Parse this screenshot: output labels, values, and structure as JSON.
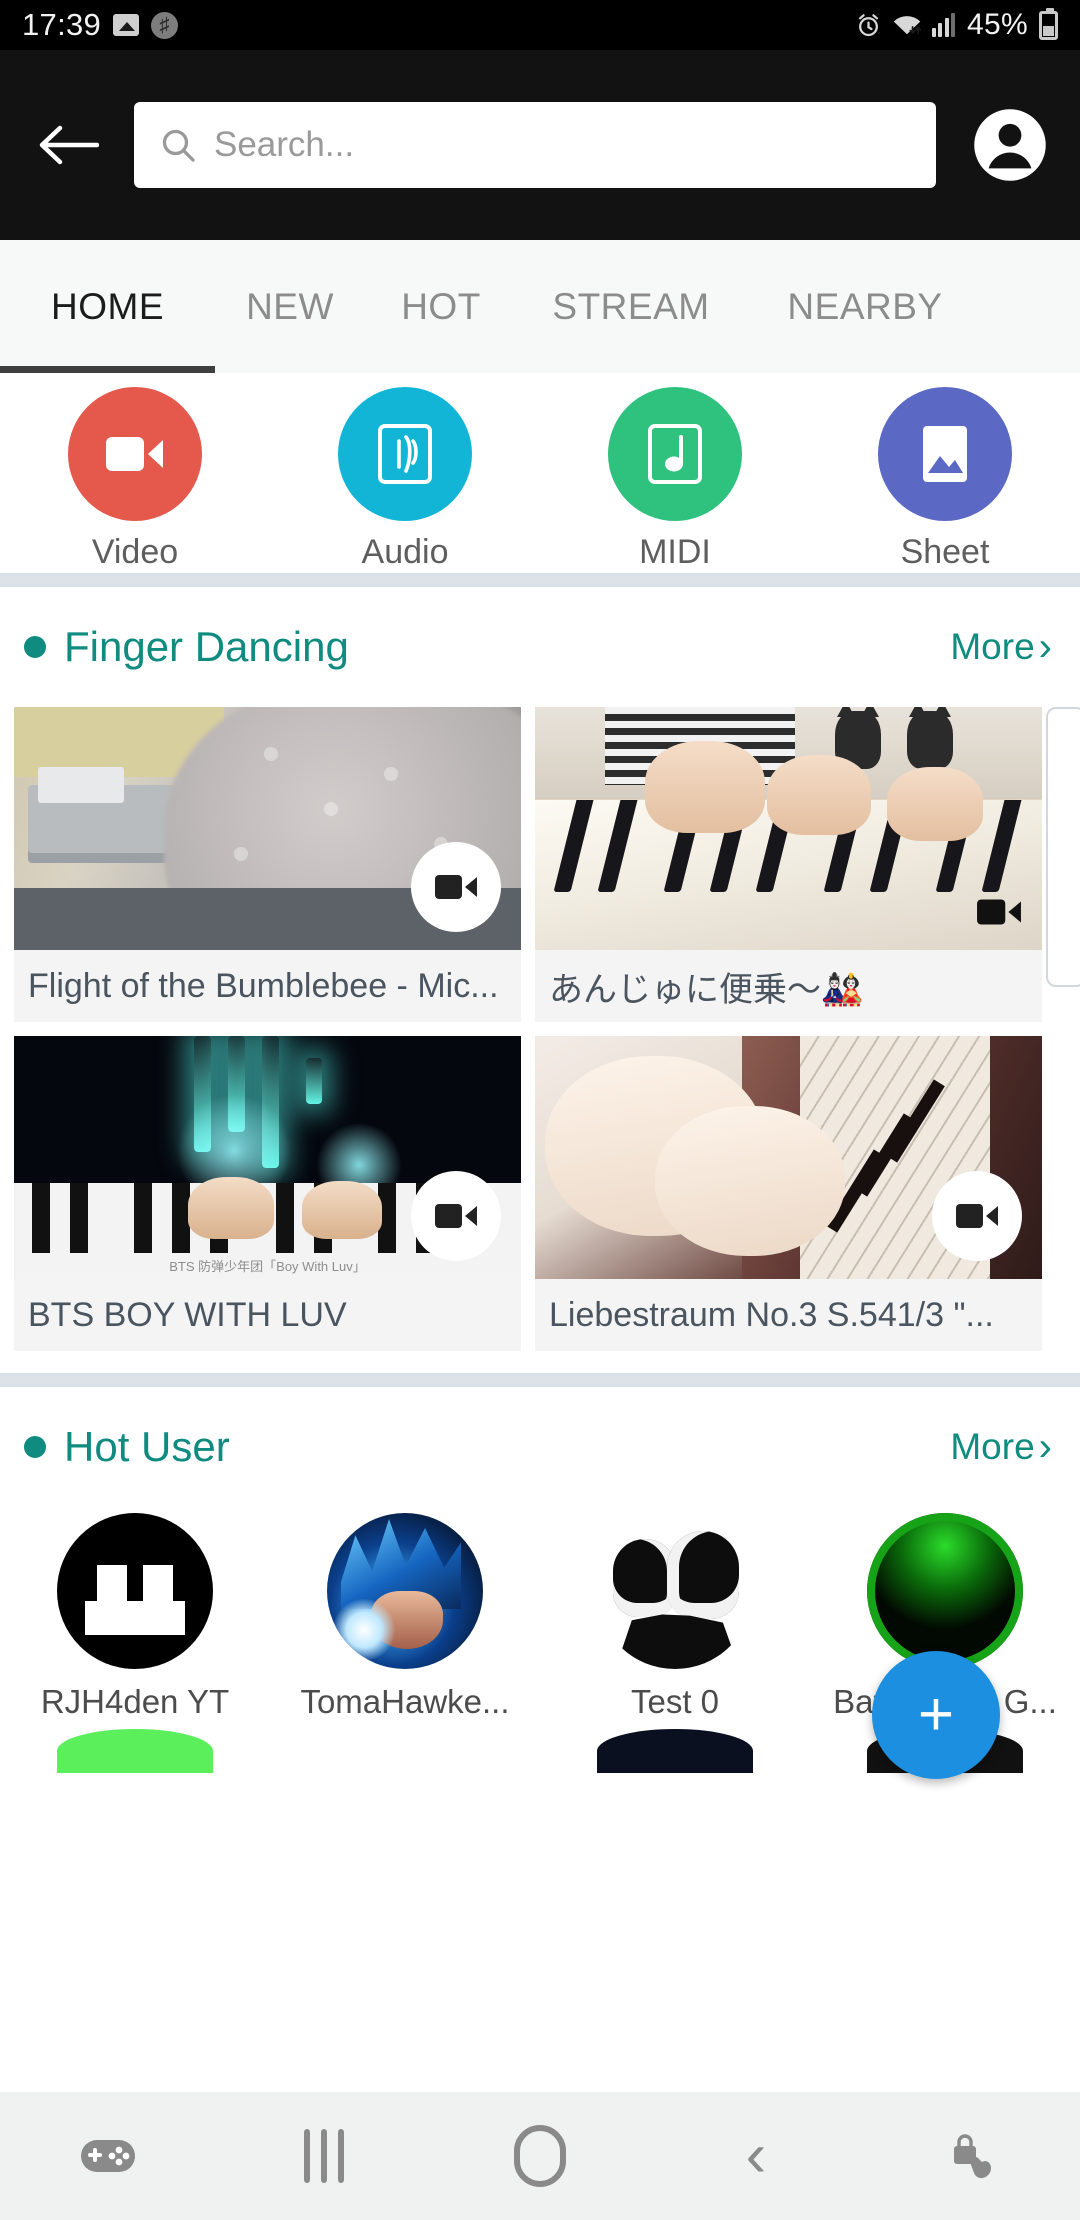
{
  "status_bar": {
    "time": "17:39",
    "icons_left": [
      "image-icon",
      "shazam-icon"
    ],
    "icons_right": [
      "alarm-icon",
      "wifi-icon",
      "signal-icon"
    ],
    "battery_percent": "45%"
  },
  "app_bar": {
    "back_icon": "back-arrow-icon",
    "search_placeholder": "Search...",
    "search_value": "",
    "search_icon": "search-icon",
    "account_icon": "account-circle-icon"
  },
  "tabs": {
    "items": [
      {
        "label": "HOME",
        "active": true
      },
      {
        "label": "NEW",
        "active": false
      },
      {
        "label": "HOT",
        "active": false
      },
      {
        "label": "STREAM",
        "active": false
      },
      {
        "label": "NEARBY",
        "active": false
      }
    ],
    "indicator_color": "#404040"
  },
  "categories": [
    {
      "label": "Video",
      "icon": "video-camera-icon",
      "color": "#e4594c"
    },
    {
      "label": "Audio",
      "icon": "audio-waves-icon",
      "color": "#12b5d6"
    },
    {
      "label": "MIDI",
      "icon": "music-note-icon",
      "color": "#2fc17e"
    },
    {
      "label": "Sheet",
      "icon": "image-sheet-icon",
      "color": "#5b69c4"
    }
  ],
  "sections": [
    {
      "title": "Finger Dancing",
      "more_label": "More",
      "accent": "#0f8b80",
      "videos": [
        {
          "title": "Flight of the Bumblebee - Mic...",
          "badge": "video-badge-large"
        },
        {
          "title": "あんじゅに便乗〜🎎",
          "badge": "video-badge-small"
        },
        {
          "title": "BTS BOY WITH LUV",
          "badge": "video-badge-large"
        },
        {
          "title": "Liebestraum No.3 S.541/3 \"...",
          "badge": "video-badge-large"
        }
      ]
    },
    {
      "title": "Hot User",
      "more_label": "More",
      "accent": "#0f8b80",
      "users": [
        {
          "name": "RJH4den YT",
          "avatar": "avatar-black-face"
        },
        {
          "name": "TomaHawke...",
          "avatar": "avatar-goku-blue"
        },
        {
          "name": "Test 0",
          "avatar": "avatar-daft-punk"
        },
        {
          "name": "Battle-Font G...",
          "avatar": "avatar-green-glow"
        }
      ]
    }
  ],
  "fab": {
    "icon": "plus-icon",
    "color": "#1c8fe0"
  },
  "nav_bar": {
    "items": [
      {
        "icon": "game-controller-icon"
      },
      {
        "icon": "recents-icon"
      },
      {
        "icon": "home-icon"
      },
      {
        "icon": "back-icon"
      },
      {
        "icon": "lock-touch-icon"
      }
    ]
  }
}
